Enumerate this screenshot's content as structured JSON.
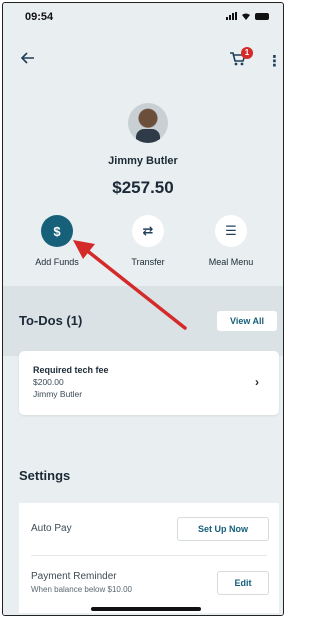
{
  "status_bar": {
    "time": "09:54"
  },
  "nav": {
    "back_icon": "arrow-left-icon",
    "cart_badge": "1"
  },
  "profile": {
    "name": "Jimmy Butler",
    "balance": "$257.50"
  },
  "actions": [
    {
      "label": "Add Funds",
      "icon_text": "$"
    },
    {
      "label": "Transfer",
      "icon_text": "⇄"
    },
    {
      "label": "Meal Menu",
      "icon_text": "☰"
    }
  ],
  "todos": {
    "title": "To-Dos (1)",
    "view_all": "View All",
    "item": {
      "title": "Required tech fee",
      "amount": "$200.00",
      "person": "Jimmy Butler"
    }
  },
  "settings": {
    "title": "Settings",
    "auto_pay": {
      "label": "Auto Pay",
      "button": "Set Up Now"
    },
    "payment_reminder": {
      "label": "Payment Reminder",
      "sub": "When balance below $10.00",
      "button": "Edit"
    }
  },
  "colors": {
    "primary": "#17607a",
    "badge": "#d42a2a",
    "annotation_arrow": "#d42a2a"
  }
}
